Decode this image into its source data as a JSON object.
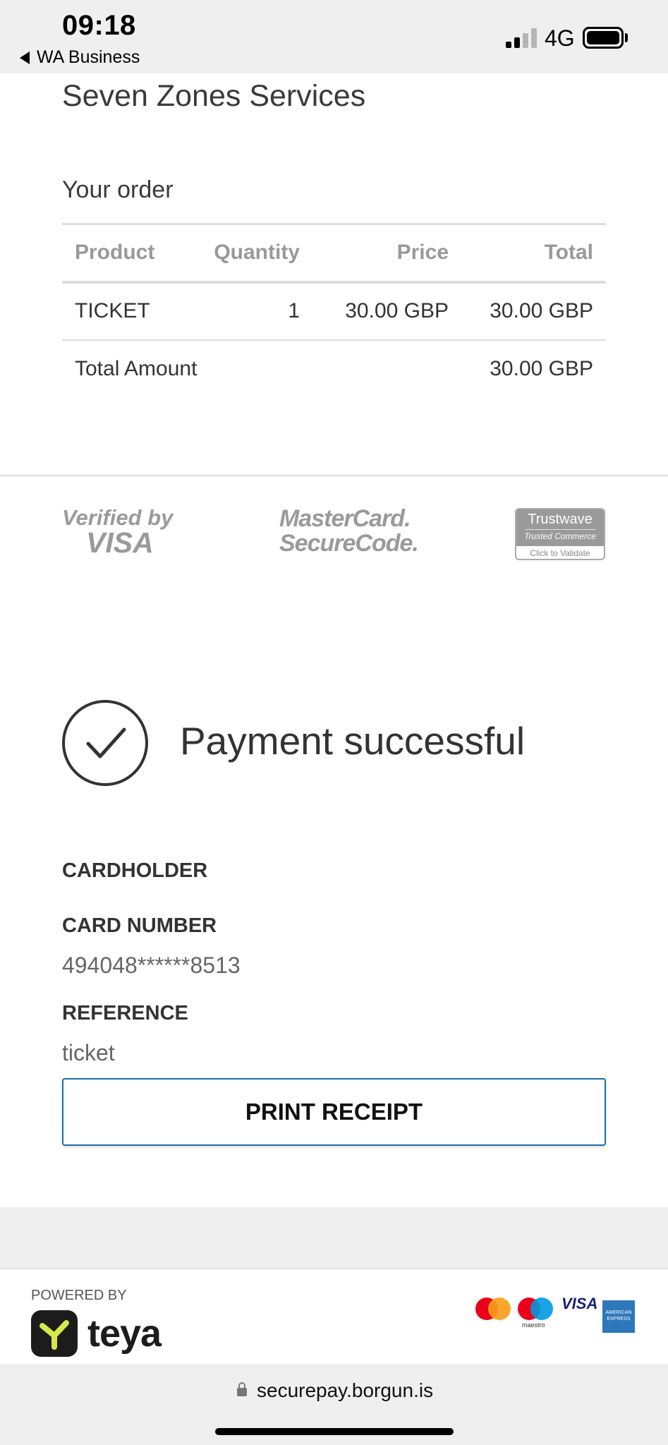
{
  "status_bar": {
    "time": "09:18",
    "back_app": "WA Business",
    "network": "4G"
  },
  "merchant": {
    "name": "Seven Zones Services"
  },
  "order": {
    "title": "Your order",
    "columns": {
      "product": "Product",
      "quantity": "Quantity",
      "price": "Price",
      "total": "Total"
    },
    "items": [
      {
        "product": "TICKET",
        "quantity": "1",
        "price": "30.00 GBP",
        "total": "30.00 GBP"
      }
    ],
    "total_label": "Total Amount",
    "total_value": "30.00 GBP"
  },
  "security_logos": {
    "verified_by_visa": {
      "line1": "Verified by",
      "line2": "VISA"
    },
    "mastercard_securecode": {
      "line1": "MasterCard.",
      "line2": "SecureCode."
    },
    "trustwave": {
      "brand": "Trustwave",
      "sub": "Trusted Commerce",
      "action": "Click to Validate"
    }
  },
  "result": {
    "message": "Payment successful",
    "cardholder_label": "CARDHOLDER",
    "card_number_label": "CARD NUMBER",
    "card_number": "494048******8513",
    "reference_label": "REFERENCE",
    "reference": "ticket",
    "print_button": "PRINT RECEIPT"
  },
  "footer": {
    "powered_by": "POWERED BY",
    "brand": "teya",
    "card_logos": [
      "mastercard-logo",
      "maestro-logo",
      "visa-logo",
      "amex-logo"
    ],
    "maestro_text": "maestro",
    "visa_text": "VISA",
    "amex_text": "AMERICAN EXPRESS"
  },
  "browser": {
    "url": "securepay.borgun.is"
  },
  "colors": {
    "button_border": "#1a6fa0",
    "teya_dark": "#1c1c1c",
    "teya_accent": "#d7e84a"
  }
}
